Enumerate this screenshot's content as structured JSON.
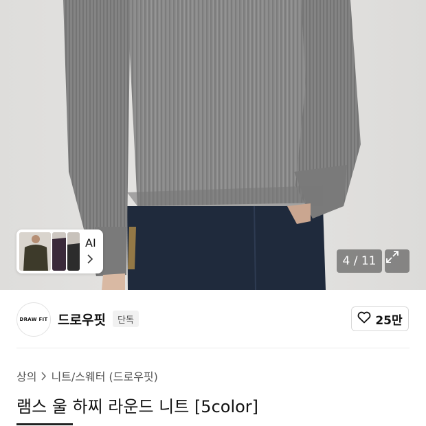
{
  "gallery": {
    "counter": "4 / 11",
    "ai_label": "AI"
  },
  "brand": {
    "logo_text": "DRAW FIT",
    "name": "드로우핏",
    "badge": "단독",
    "like_count": "25만"
  },
  "breadcrumb": {
    "items": [
      "상의",
      "니트/스웨터 (드로우핏)"
    ]
  },
  "product": {
    "title": "램스 울 하찌 라운드 니트 [5color]"
  },
  "colors": {
    "sweater": "#8a8a8a",
    "jeans": "#1f2a3c",
    "background": "#e2e1df"
  }
}
